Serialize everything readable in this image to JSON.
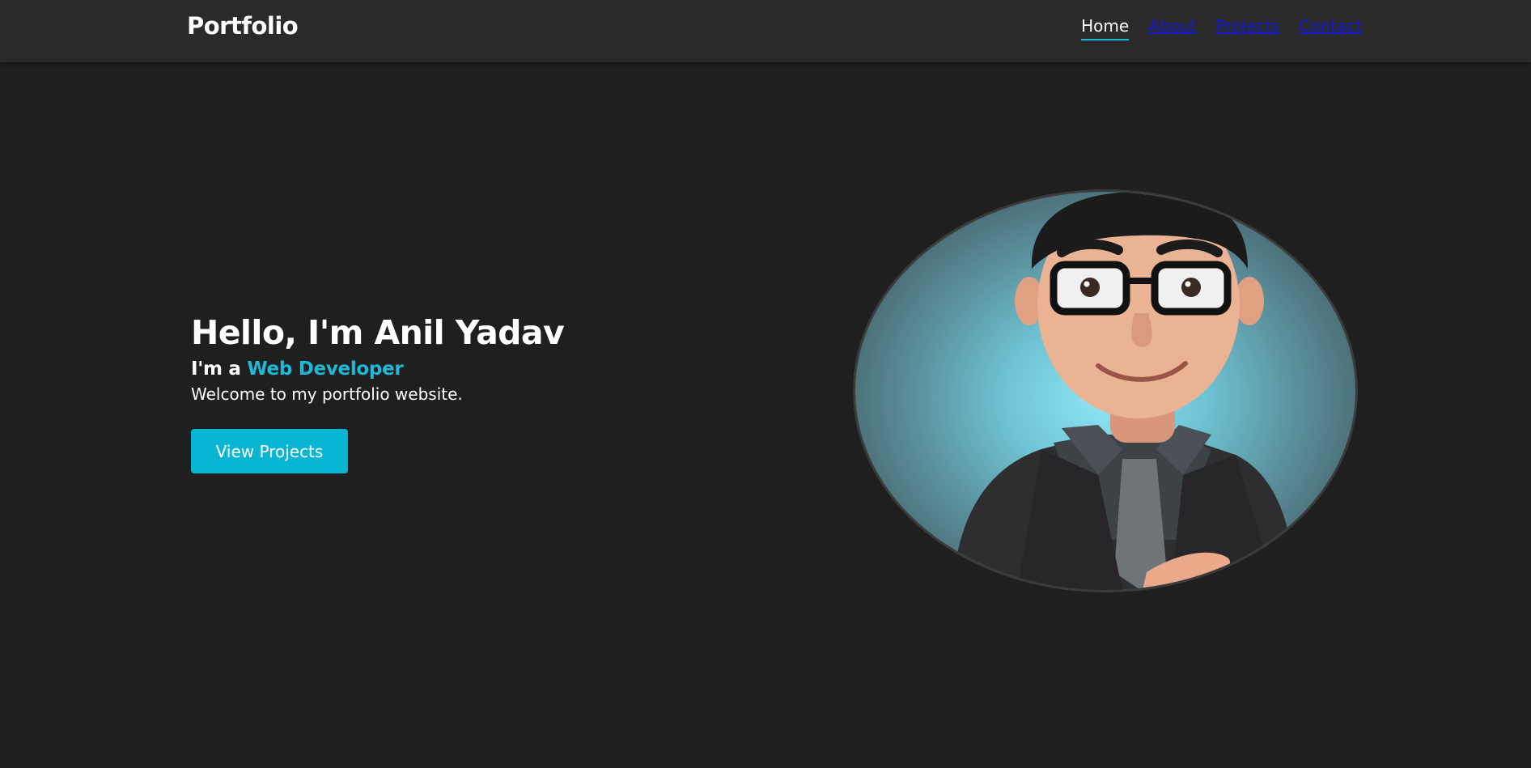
{
  "nav": {
    "brand": "Portfolio",
    "links": [
      "Home",
      "About",
      "Projects",
      "Contact"
    ]
  },
  "hero": {
    "title": "Hello, I'm Anil Yadav",
    "subtitle_prefix": "I'm a ",
    "role": "Web Developer",
    "welcome": "Welcome to my portfolio website.",
    "cta_label": "View Projects"
  },
  "colors": {
    "background": "#1f1f1f",
    "navbar": "#2a2a2a",
    "accent": "#1fb8d6",
    "link": "#1717d6"
  },
  "icons": {
    "avatar": "cartoon-developer-portrait"
  }
}
